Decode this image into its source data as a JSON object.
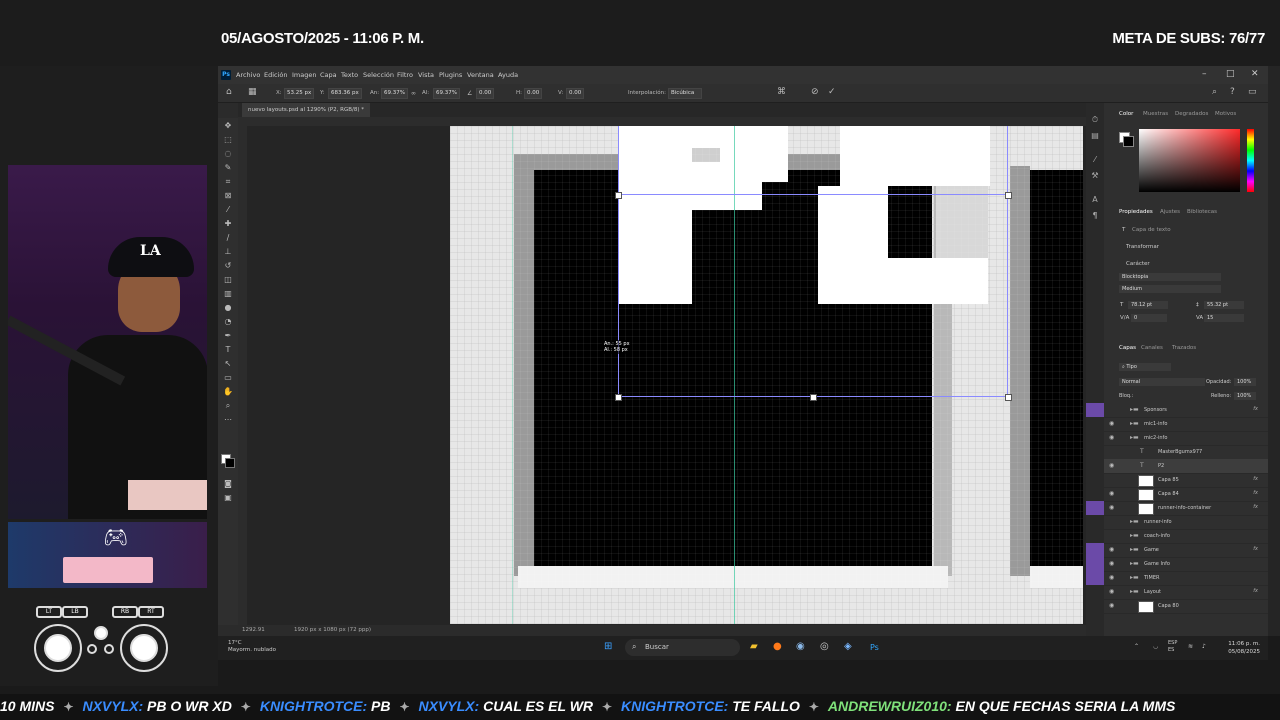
{
  "stream": {
    "date_time": "05/AGOSTO/2025 - 11:06 P. M.",
    "subs_goal": "META DE SUBS: 76/77"
  },
  "photoshop": {
    "menu": [
      "Archivo",
      "Edición",
      "Imagen",
      "Capa",
      "Texto",
      "Selección",
      "Filtro",
      "Vista",
      "Plugins",
      "Ventana",
      "Ayuda"
    ],
    "options": {
      "x_label": "X:",
      "x_value": "53.25 px",
      "y_label": "Y:",
      "y_value": "683.36 px",
      "w_label": "An:",
      "w_value": "69.37%",
      "h_label": "Al:",
      "h_value": "69.37%",
      "angle_value": "0.00",
      "hskew_label": "H:",
      "hskew_value": "0.00",
      "vskew_label": "V:",
      "vskew_value": "0.00",
      "interp_label": "Interpolación:",
      "interp_value": "Bicúbica"
    },
    "doc_tab": "nuevo layouts.psd al 1290% (P2, RGB/8) *",
    "size_tip": {
      "w": "An.: 55 px",
      "h": "Al.: 58 px"
    },
    "status": {
      "zoom": "1292.91",
      "doc_size": "1920 px x 1080 px (72 ppp)"
    },
    "panels": {
      "color_tabs": [
        "Color",
        "Muestras",
        "Degradados",
        "Motivos"
      ],
      "prop_tabs": [
        "Propiedades",
        "Ajustes",
        "Bibliotecas"
      ],
      "layer_type": "Capa de texto",
      "transform": "Transformar",
      "character": "Carácter",
      "font": "Blocktopia",
      "style": "Medium",
      "font_size": "78.12 pt",
      "leading": "55.32 pt",
      "kerning": "0",
      "tracking": "15",
      "layers_tabs": [
        "Capas",
        "Canales",
        "Trazados"
      ],
      "filter": "Tipo",
      "blend_mode": "Normal",
      "opacity_label": "Opacidad:",
      "opacity": "100%",
      "lock_label": "Bloq.:",
      "fill_label": "Relleno:",
      "fill": "100%",
      "layers": [
        {
          "name": "Sponsors",
          "kind": "folder",
          "fx": true,
          "visible": false,
          "purple": true
        },
        {
          "name": "mic1-info",
          "kind": "folder",
          "fx": false,
          "visible": true,
          "purple": false
        },
        {
          "name": "mic2-info",
          "kind": "folder",
          "fx": false,
          "visible": true,
          "purple": false
        },
        {
          "name": "MasterBgumx977",
          "kind": "text",
          "fx": false,
          "visible": false,
          "purple": false
        },
        {
          "name": "P2",
          "kind": "text",
          "fx": false,
          "visible": true,
          "purple": false,
          "selected": true
        },
        {
          "name": "Capa 85",
          "kind": "image",
          "fx": true,
          "visible": false,
          "purple": false
        },
        {
          "name": "Capa 84",
          "kind": "image",
          "fx": true,
          "visible": true,
          "purple": false
        },
        {
          "name": "runner-info-container",
          "kind": "image",
          "fx": true,
          "visible": true,
          "purple": true
        },
        {
          "name": "runner-info",
          "kind": "folder",
          "fx": false,
          "visible": false,
          "purple": false
        },
        {
          "name": "coach-info",
          "kind": "folder",
          "fx": false,
          "visible": false,
          "purple": false
        },
        {
          "name": "Game",
          "kind": "folder",
          "fx": true,
          "visible": true,
          "purple": true
        },
        {
          "name": "Game Info",
          "kind": "folder",
          "fx": false,
          "visible": true,
          "purple": true
        },
        {
          "name": "TIMER",
          "kind": "folder",
          "fx": false,
          "visible": true,
          "purple": true
        },
        {
          "name": "Layout",
          "kind": "folder",
          "fx": true,
          "visible": true,
          "purple": false
        },
        {
          "name": "Capa 80",
          "kind": "image",
          "fx": false,
          "visible": true,
          "purple": false
        }
      ]
    }
  },
  "taskbar": {
    "weather_temp": "17°C",
    "weather_desc": "Mayorm. nublado",
    "search": "Buscar",
    "lang": "ESP",
    "region": "ES",
    "time": "11:06 p. m.",
    "date": "05/08/2025"
  },
  "ticker": [
    {
      "user": "",
      "msg": "10 MINS"
    },
    {
      "user": "NXVYLX:",
      "msg": "PB O WR XD"
    },
    {
      "user": "KNIGHTROTCE:",
      "msg": "PB"
    },
    {
      "user": "NXVYLX:",
      "msg": "CUAL ES EL WR"
    },
    {
      "user": "KNIGHTROTCE:",
      "msg": "TE FALLO"
    },
    {
      "user": "ANDREWRUIZ010:",
      "msg": "EN QUE FECHAS SERIA LA MMS",
      "green": true
    }
  ],
  "controller": {
    "lt": "LT",
    "lb": "LB",
    "rb": "RB",
    "rt": "RT"
  }
}
